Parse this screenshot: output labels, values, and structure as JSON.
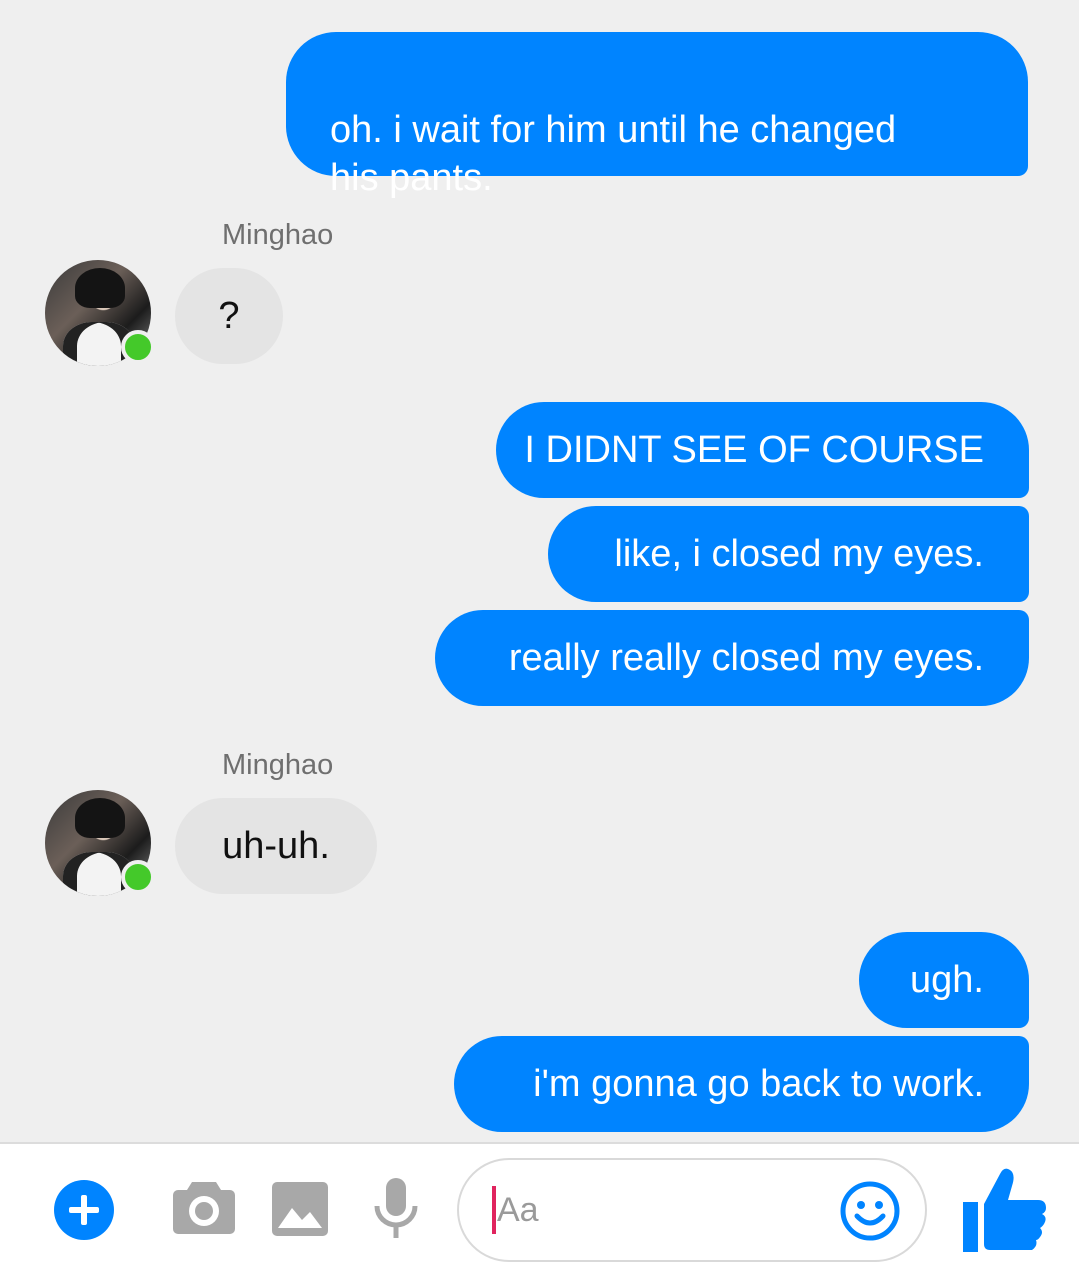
{
  "conversation": {
    "messages": [
      {
        "from": "me",
        "text": "oh. i wait for him until he changed\nhis pants."
      },
      {
        "from": "Minghao",
        "sender_label": "Minghao",
        "text": "?"
      },
      {
        "from": "me",
        "text": "I DIDNT SEE OF COURSE"
      },
      {
        "from": "me",
        "text": "like, i closed my eyes."
      },
      {
        "from": "me",
        "text": "really really closed my eyes."
      },
      {
        "from": "Minghao",
        "sender_label": "Minghao",
        "text": "uh-uh."
      },
      {
        "from": "me",
        "text": "ugh."
      },
      {
        "from": "me",
        "text": "i'm gonna go back to work."
      }
    ]
  },
  "contact": {
    "name": "Minghao",
    "status": "online",
    "status_color": "#44c92a"
  },
  "composer": {
    "placeholder": "Aa",
    "icons": [
      "plus-icon",
      "camera-icon",
      "image-icon",
      "microphone-icon",
      "emoji-icon",
      "thumbs-up-icon"
    ]
  },
  "colors": {
    "outgoing_bubble": "#0084ff",
    "incoming_bubble": "#e4e4e4",
    "background": "#efefef",
    "accent": "#0084ff",
    "muted_icon": "#a8a8a8"
  }
}
